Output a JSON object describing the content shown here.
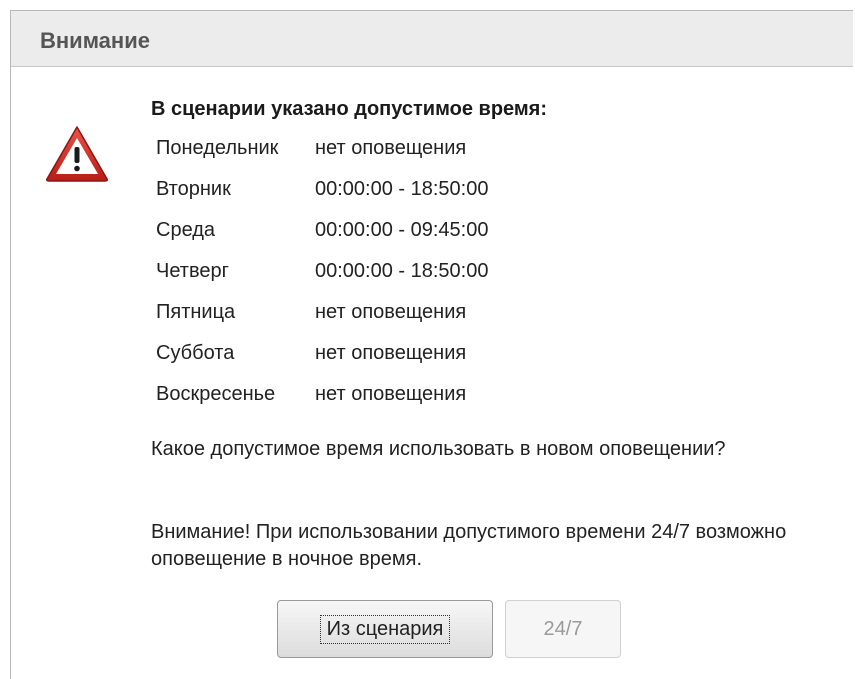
{
  "dialog": {
    "title": "Внимание",
    "heading": "В сценарии указано допустимое время:",
    "schedule": [
      {
        "day": "Понедельник",
        "time": "нет оповещения"
      },
      {
        "day": "Вторник",
        "time": "00:00:00 - 18:50:00"
      },
      {
        "day": "Среда",
        "time": "00:00:00 - 09:45:00"
      },
      {
        "day": "Четверг",
        "time": "00:00:00 - 18:50:00"
      },
      {
        "day": "Пятница",
        "time": "нет оповещения"
      },
      {
        "day": "Суббота",
        "time": "нет оповещения"
      },
      {
        "day": "Воскресенье",
        "time": "нет оповещения"
      }
    ],
    "question": "Какое допустимое время использовать в новом оповещении?",
    "warning_text": "Внимание! При использовании допустимого времени 24/7 возможно оповещение в ночное время.",
    "buttons": {
      "from_scenario": "Из сценария",
      "always": "24/7"
    },
    "icon": "warning-triangle-icon",
    "colors": {
      "warning_red": "#cc2a22",
      "title_bar": "#ececec",
      "title_text": "#555555"
    }
  }
}
